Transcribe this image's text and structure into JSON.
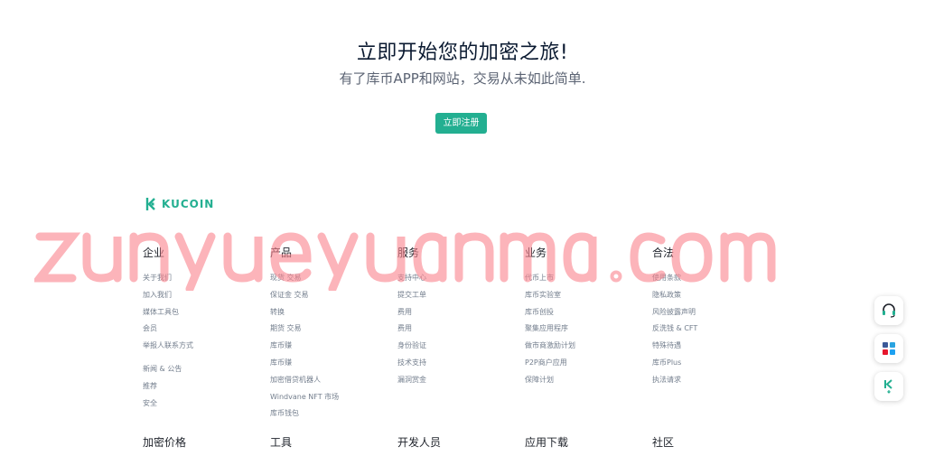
{
  "hero": {
    "title": "立即开始您的加密之旅!",
    "subtitle": "有了库币APP和网站，交易从未如此简单.",
    "cta_label": "立即注册"
  },
  "logo": {
    "text": "KUCOIN"
  },
  "watermark": {
    "text": "zunyueyuanma.com"
  },
  "columns": [
    {
      "title": "企业",
      "items": [
        "关于我们",
        "加入我们",
        "媒体工具包",
        "会员",
        "举报人联系方式",
        "新闻 & 公告",
        "推荐",
        "安全"
      ]
    },
    {
      "title": "产品",
      "items": [
        "现货 交易",
        "保证金 交易",
        "转换",
        "期货 交易",
        "库币赚",
        "库币赚",
        "加密借贷机器人",
        "Windvane NFT 市场",
        "库币钱包"
      ]
    },
    {
      "title": "服务",
      "items": [
        "支持中心",
        "提交工单",
        "费用",
        "费用",
        "身份验证",
        "技术支持",
        "漏洞赏金"
      ]
    },
    {
      "title": "业务",
      "items": [
        "代币上市",
        "库币实验室",
        "库币创投",
        "聚集应用程序",
        "做市商激励计划",
        "P2P商户应用",
        "保障计划"
      ]
    },
    {
      "title": "合法",
      "items": [
        "使用条款",
        "隐私政策",
        "风险披露声明",
        "反洗钱 & CFT",
        "特殊待遇",
        "库币Plus",
        "执法请求"
      ]
    }
  ],
  "bottom_row": [
    "加密价格",
    "工具",
    "开发人员",
    "应用下载",
    "社区"
  ],
  "floating": [
    {
      "icon": "headset-icon"
    },
    {
      "icon": "social-links-icon"
    },
    {
      "icon": "app-download-icon"
    }
  ],
  "colors": {
    "accent": "#23af91",
    "title": "#0a1930",
    "muted": "#737e8d"
  }
}
